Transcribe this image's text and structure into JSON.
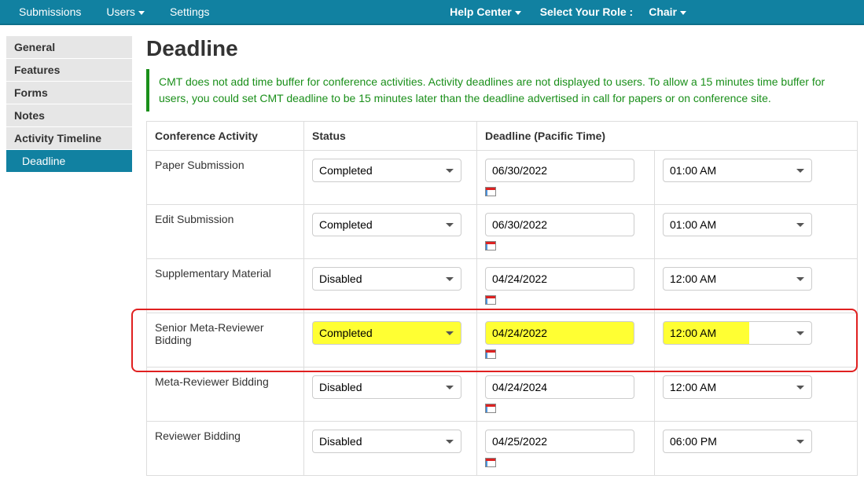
{
  "topnav": {
    "left": [
      {
        "label": "Submissions",
        "name": "nav-submissions"
      },
      {
        "label": "Users",
        "name": "nav-users",
        "caret": true
      },
      {
        "label": "Settings",
        "name": "nav-settings"
      }
    ],
    "help_label": "Help Center",
    "role_label": "Select Your Role :",
    "role_value": "Chair"
  },
  "sidebar": {
    "items": [
      {
        "label": "General",
        "name": "side-general"
      },
      {
        "label": "Features",
        "name": "side-features"
      },
      {
        "label": "Forms",
        "name": "side-forms"
      },
      {
        "label": "Notes",
        "name": "side-notes"
      },
      {
        "label": "Activity Timeline",
        "name": "side-activity-timeline"
      }
    ],
    "sub": {
      "label": "Deadline",
      "name": "side-deadline"
    }
  },
  "page": {
    "title": "Deadline",
    "alert": "CMT does not add time buffer for conference activities. Activity deadlines are not displayed to users. To allow a 15 minutes time buffer for users, you could set CMT deadline to be 15 minutes later than the deadline advertised in call for papers or on conference site."
  },
  "table": {
    "headers": {
      "activity": "Conference Activity",
      "status": "Status",
      "deadline": "Deadline (Pacific Time)"
    },
    "rows": [
      {
        "activity": "Paper Submission",
        "status": "Completed",
        "date": "06/30/2022",
        "time": "01:00 AM",
        "hl": false
      },
      {
        "activity": "Edit Submission",
        "status": "Completed",
        "date": "06/30/2022",
        "time": "01:00 AM",
        "hl": false
      },
      {
        "activity": "Supplementary Material",
        "status": "Disabled",
        "date": "04/24/2022",
        "time": "12:00 AM",
        "hl": false
      },
      {
        "activity": "Senior Meta-Reviewer Bidding",
        "status": "Completed",
        "date": "04/24/2022",
        "time": "12:00 AM",
        "hl": true
      },
      {
        "activity": "Meta-Reviewer Bidding",
        "status": "Disabled",
        "date": "04/24/2024",
        "time": "12:00 AM",
        "hl": false
      },
      {
        "activity": "Reviewer Bidding",
        "status": "Disabled",
        "date": "04/25/2022",
        "time": "06:00 PM",
        "hl": false
      }
    ],
    "status_options": [
      "Completed",
      "Disabled"
    ]
  }
}
